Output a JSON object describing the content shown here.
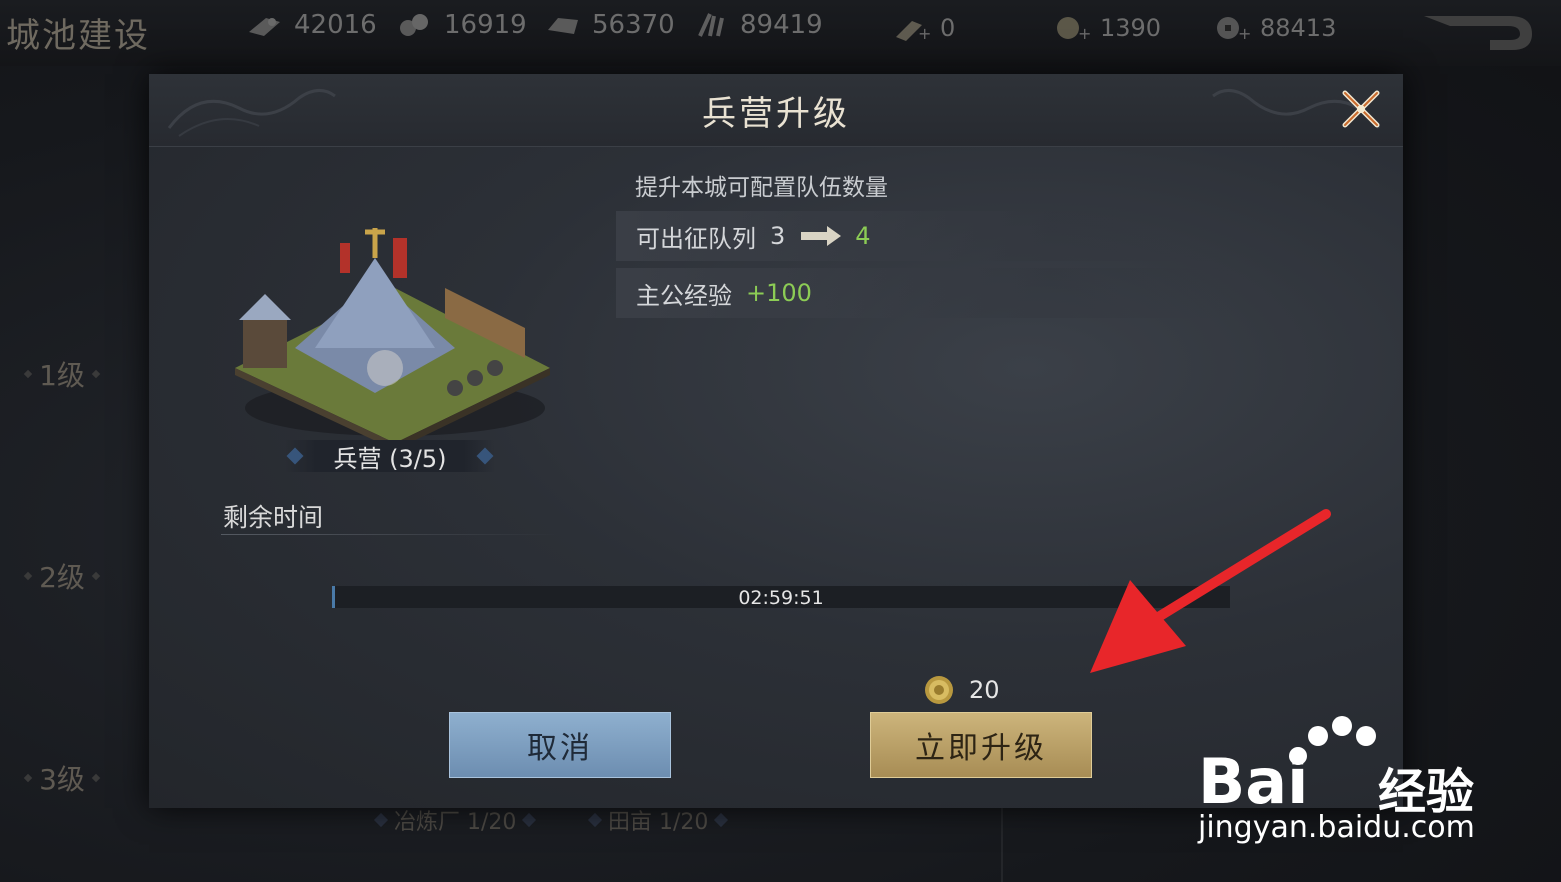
{
  "page": {
    "title": "城池建设"
  },
  "resources": [
    {
      "icon": "wood-icon",
      "value": "42016"
    },
    {
      "icon": "iron-icon",
      "value": "16919"
    },
    {
      "icon": "stone-icon",
      "value": "56370"
    },
    {
      "icon": "grain-icon",
      "value": "89419"
    },
    {
      "icon": "gold-bar-icon",
      "value": "0"
    },
    {
      "icon": "jade-coin-icon",
      "value": "1390"
    },
    {
      "icon": "copper-coin-icon",
      "value": "88413"
    }
  ],
  "side_levels": [
    "1级",
    "2级",
    "3级"
  ],
  "bottom_tags": [
    "冶炼厂 1/20",
    "田亩 1/20"
  ],
  "dialog": {
    "title": "兵营升级",
    "building_label": "兵营 (3/5)",
    "description": "提升本城可配置队伍数量",
    "stat_queue": {
      "label": "可出征队列",
      "from": "3",
      "to": "4"
    },
    "stat_exp": {
      "label": "主公经验",
      "gain": "+100"
    },
    "remaining_time_label": "剩余时间",
    "timer": "02:59:51",
    "progress_fraction": 0.003,
    "cost_value": "20",
    "cancel_label": "取消",
    "upgrade_label": "立即升级"
  },
  "watermark": {
    "brand": "Bai",
    "brand_suffix": "经验",
    "url": "jingyan.baidu.com"
  },
  "colors": {
    "accent_green": "#8ccc55",
    "annotation_red": "#e8262a",
    "upgrade_gold": "#cdb57c",
    "cancel_blue": "#8fb0cf"
  }
}
